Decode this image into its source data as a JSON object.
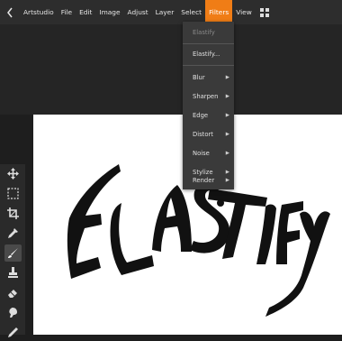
{
  "menubar": {
    "items": [
      "Artstudio",
      "File",
      "Edit",
      "Image",
      "Adjust",
      "Layer",
      "Select",
      "Filters",
      "View"
    ],
    "active": "Filters"
  },
  "filters_menu": {
    "items": [
      {
        "label": "Elastify",
        "state": "disabled"
      },
      {
        "label": "Elastify...",
        "state": "enabled"
      },
      {
        "label": "Blur",
        "submenu": true
      },
      {
        "label": "Sharpen",
        "submenu": true
      },
      {
        "label": "Edge",
        "submenu": true
      },
      {
        "label": "Distort",
        "submenu": true
      },
      {
        "label": "Noise",
        "submenu": true
      },
      {
        "label": "Stylize",
        "submenu": true
      },
      {
        "label": "Render",
        "submenu": true
      }
    ]
  },
  "toolbar": {
    "tools": [
      "move-icon",
      "marquee-select-icon",
      "crop-icon",
      "eyedropper-icon",
      "brush-icon",
      "stamp-icon",
      "eraser-icon",
      "smudge-icon",
      "pencil-icon"
    ],
    "active_tool": "brush-icon"
  },
  "canvas": {
    "artwork_text": "ELASTIFY"
  },
  "colors": {
    "accent": "#f07d16",
    "menubar_bg": "#2d2d2d",
    "canvas_bg": "#ffffff"
  }
}
